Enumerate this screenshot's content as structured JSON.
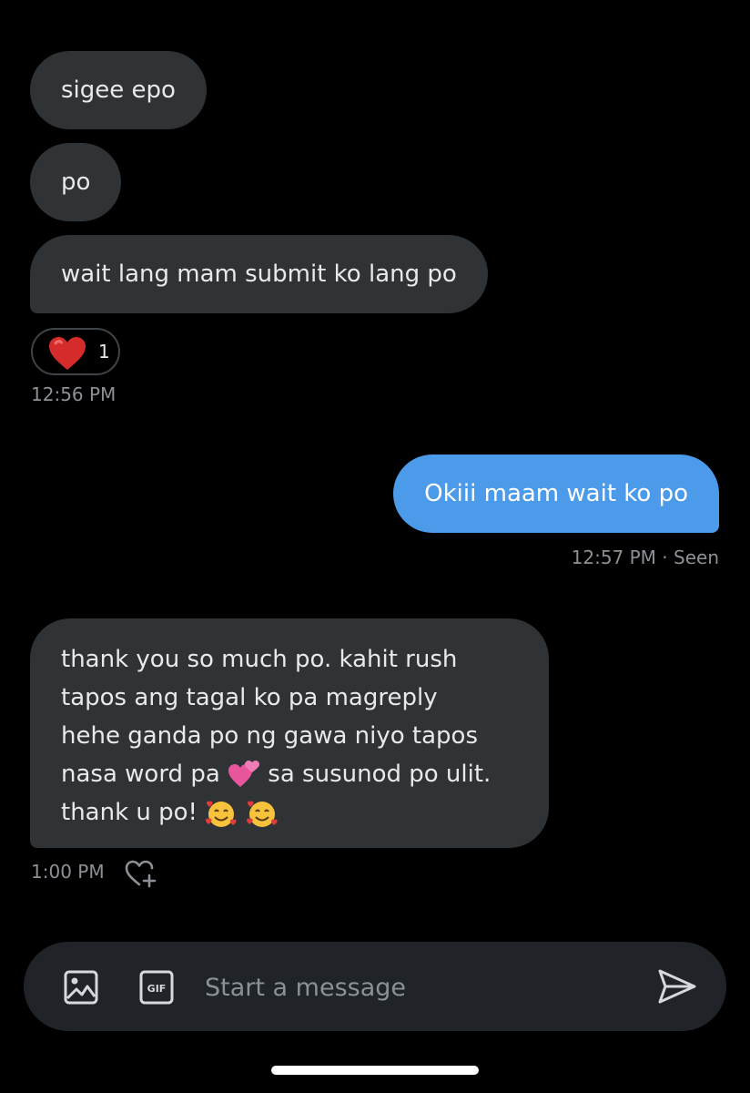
{
  "messages": {
    "received_1": "sigee epo",
    "received_2": "po",
    "received_3": "wait lang mam submit ko lang po",
    "reaction_emoji": "red-heart",
    "reaction_count": "1",
    "time_1": "12:56 PM",
    "sent_1": "Okiii maam wait ko po",
    "time_2": "12:57 PM · Seen",
    "received_4": {
      "line1": "thank you so much po. kahit rush",
      "line2": "tapos ang tagal ko pa magreply",
      "line3": "hehe ganda po ng gawa niyo tapos",
      "line4a": "nasa word pa",
      "line4_emoji": "two-hearts",
      "line4b": "sa susunod po ulit.",
      "line5": "thank u po!",
      "line5_emoji": "smiling-face-with-hearts"
    },
    "time_3": "1:00 PM"
  },
  "composer": {
    "placeholder": "Start a message",
    "gif_label": "GIF",
    "icons": [
      "image-icon",
      "gif-icon",
      "send-icon"
    ]
  },
  "colors": {
    "background": "#000000",
    "received_bubble": "#2f3336",
    "sent_bubble": "#4b9bea",
    "muted_text": "#8b9196",
    "composer_bg": "#202327"
  }
}
